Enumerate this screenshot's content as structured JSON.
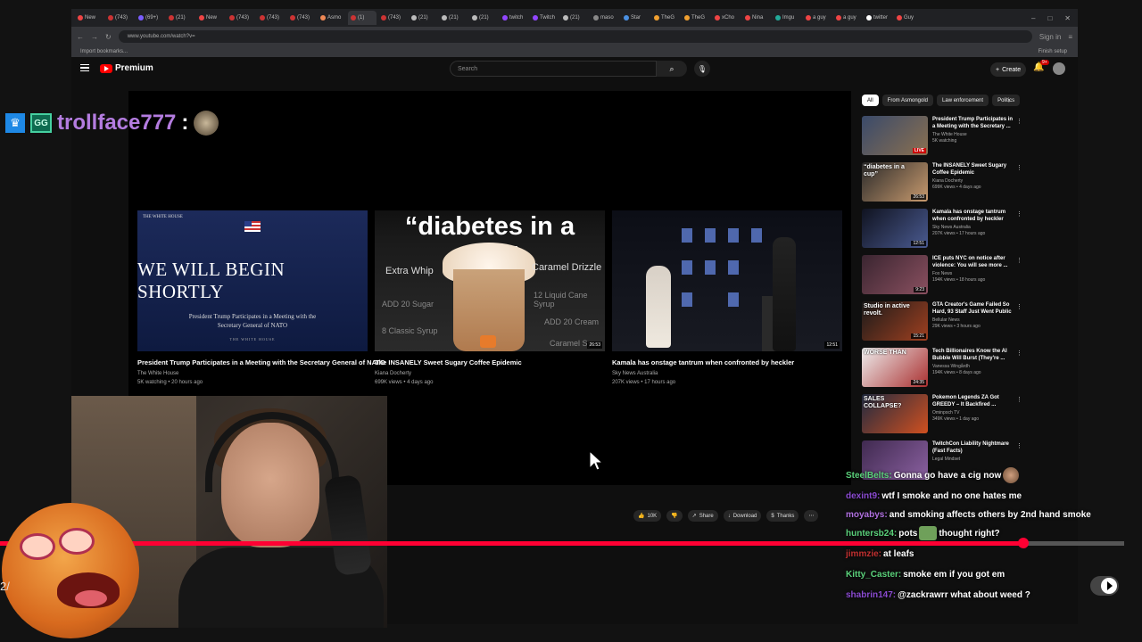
{
  "browser": {
    "tabs": [
      "New",
      "(743)",
      "(69+)",
      "(21)",
      "New",
      "(743)",
      "(743)",
      "(743)",
      "Asmo",
      "(1)",
      "(743)",
      "(21)",
      "(21)",
      "(21)",
      "twitch",
      "Twitch",
      "(21)",
      "maso",
      "Star",
      "TheG",
      "TheG",
      "xCho",
      "Nina",
      "Imgu",
      "a guy",
      "a guy",
      "twitter",
      "Guy"
    ],
    "url": "www.youtube.com/watch?v=",
    "bookmarks_label": "Import bookmarks...",
    "finish_setup": "Finish setup",
    "sign_in": "Sign in"
  },
  "youtube": {
    "brand": "Premium",
    "search_placeholder": "Search",
    "create_label": "Create",
    "notif_count": "9+"
  },
  "endcards": [
    {
      "title": "President Trump Participates in a Meeting with the Secretary General of NATO",
      "channel": "The White House",
      "meta": "5K watching • 20 hours ago",
      "thumb": {
        "header": "THE WHITE HOUSE",
        "big": "WE WILL BEGIN SHORTLY",
        "sub": "President Trump Participates in a Meeting with the Secretary General of NATO",
        "footer": "THE WHITE HOUSE"
      }
    },
    {
      "title": "The INSANELY Sweet Sugary Coffee Epidemic",
      "channel": "Kiana Docherty",
      "meta": "699K views • 4 days ago",
      "duration": "26:53",
      "thumb": {
        "headline": "“diabetes in a cup”",
        "labels": [
          "Extra Whip",
          "Caramel Drizzle",
          "ADD 20 Sugar",
          "12 Liquid Cane Syrup",
          "ADD 20 Cream",
          "8 Classic Syrup",
          "Caramel Sy"
        ]
      }
    },
    {
      "title": "Kamala has onstage tantrum when confronted by heckler",
      "channel": "Sky News Australia",
      "meta": "207K views • 17 hours ago",
      "duration": "12:51"
    }
  ],
  "player_controls": {
    "likes": "10K",
    "share": "Share",
    "download": "Download",
    "thanks": "Thanks"
  },
  "sidebar": {
    "chips": [
      "All",
      "From Asmongold",
      "Law enforcement",
      "Politics"
    ],
    "items": [
      {
        "title": "President Trump Participates in a Meeting with the Secretary ...",
        "channel": "The White House",
        "meta": "5K watching",
        "badge": "LIVE",
        "colors": [
          "#3a4a6a",
          "#8a7050"
        ]
      },
      {
        "title": "The INSANELY Sweet Sugary Coffee Epidemic",
        "channel": "Kiana Docherty",
        "meta": "699K views • 4 days ago",
        "badge": "26:53",
        "overlay": "“diabetes in a cup”",
        "colors": [
          "#2a2a2a",
          "#c89a6e"
        ]
      },
      {
        "title": "Kamala has onstage tantrum when confronted by heckler",
        "channel": "Sky News Australia",
        "meta": "207K views • 17 hours ago",
        "badge": "12:51",
        "colors": [
          "#101320",
          "#4a5a90"
        ]
      },
      {
        "title": "ICE puts NYC on notice after violence: You will see more ...",
        "channel": "Fox News",
        "meta": "194K views • 18 hours ago",
        "badge": "9:23",
        "colors": [
          "#3a2530",
          "#8a5060"
        ]
      },
      {
        "title": "GTA Creator's Game Failed So Hard, 93 Staff Just Went Public",
        "channel": "Bellular News",
        "meta": "29K views • 3 hours ago",
        "badge": "15:21",
        "overlay": "Studio in active revolt.",
        "colors": [
          "#1a1a1a",
          "#a04020"
        ]
      },
      {
        "title": "Tech Billionaires Know the AI Bubble Will Burst (They're ...",
        "channel": "Vanessa Wingårdh",
        "meta": "194K views • 8 days ago",
        "badge": "24:35",
        "overlay": "WORSE THAN",
        "colors": [
          "#eee",
          "#aa3030"
        ]
      },
      {
        "title": "Pokemon Legends ZA Got GREEDY – It Backfired ...",
        "channel": "Ominpoch TV",
        "meta": "349K views • 1 day ago",
        "badge": "",
        "overlay": "SALES COLLAPSE?",
        "colors": [
          "#202a40",
          "#d05020"
        ]
      },
      {
        "title": "TwitchCon Liability Nightmare (Fast Facts)",
        "channel": "Legal Mindset",
        "meta": "",
        "badge": "",
        "colors": [
          "#402a50",
          "#8a60a0"
        ]
      }
    ]
  },
  "overlay_user": {
    "badge_text": "GG",
    "name": "trollface777",
    "colon": ":"
  },
  "chat": [
    {
      "user": "SteelBelts:",
      "color": "#5ad07a",
      "text": "Gonna go have a cig now",
      "emote": "face"
    },
    {
      "user": "dexint9:",
      "color": "#8a4ad0",
      "text": "wtf I smoke and no one hates me"
    },
    {
      "user": "moyabys:",
      "color": "#b070e0",
      "text": "and smoking affects others by 2nd hand smoke",
      "wrap": true
    },
    {
      "user": "huntersb24:",
      "color": "#5ad07a",
      "text_before": "pots",
      "emote": "green",
      "text": "thought right?"
    },
    {
      "user": "jimmzie:",
      "color": "#c03030",
      "text": "at leafs"
    },
    {
      "user": "Kitty_Caster:",
      "color": "#5ad07a",
      "text": "smoke em if you got em"
    },
    {
      "user": "shabrin147:",
      "color": "#8a4ad0",
      "text": "@zackrawrr what about weed ?"
    }
  ],
  "progress": {
    "fraction": 0.91
  },
  "left_text": "2/",
  "colors": {
    "accent": "#ff0033",
    "brand": "#ff0000"
  }
}
